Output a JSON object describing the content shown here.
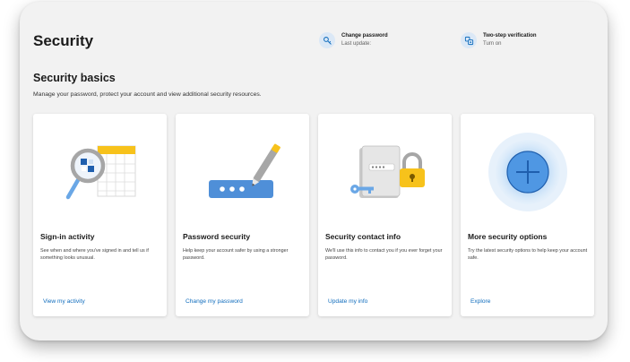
{
  "header": {
    "title": "Security"
  },
  "status": [
    {
      "icon": "key-icon",
      "title": "Change password",
      "subtitle": "Last update:"
    },
    {
      "icon": "two-step-icon",
      "title": "Two-step verification",
      "subtitle": "Turn on"
    }
  ],
  "basics": {
    "title": "Security basics",
    "description": "Manage your password, protect your account and view additional security resources."
  },
  "cards": [
    {
      "title": "Sign-in activity",
      "description": "See when and where you've signed in and tell us if something looks unusual.",
      "link": "View my activity",
      "illustration": "magnifier-calendar-icon"
    },
    {
      "title": "Password security",
      "description": "Help keep your account safer by using a stronger password.",
      "link": "Change my password",
      "illustration": "password-pen-icon"
    },
    {
      "title": "Security contact info",
      "description": "We'll use this info to contact you if you ever forget your password.",
      "link": "Update my info",
      "illustration": "contact-lock-icon"
    },
    {
      "title": "More security options",
      "description": "Try the latest security options to help keep your account safe.",
      "link": "Explore",
      "illustration": "plus-circle-icon"
    }
  ],
  "colors": {
    "accent": "#0f6cbd",
    "background": "#f2f2f2",
    "card": "#ffffff"
  }
}
